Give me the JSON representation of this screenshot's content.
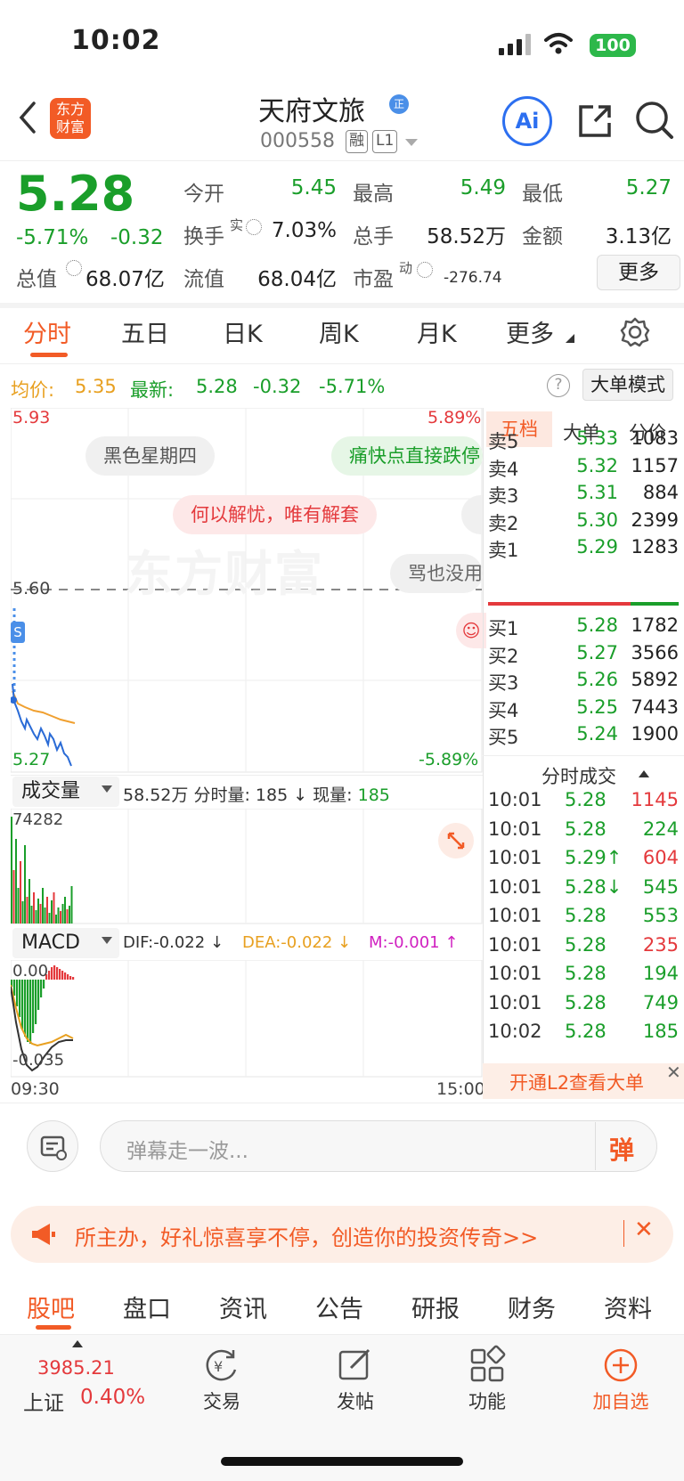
{
  "status": {
    "time": "10:02",
    "battery": "100"
  },
  "header": {
    "logo": "东方财富",
    "title": "天府文旅",
    "code": "000558",
    "tag1": "融",
    "tag2": "L1"
  },
  "quote": {
    "price": "5.28",
    "pct": "-5.71%",
    "chg": "-0.32",
    "rows": [
      [
        {
          "l": "今开",
          "v": "5.45"
        },
        {
          "l": "最高",
          "v": "5.49"
        },
        {
          "l": "最低",
          "v": "5.27"
        }
      ],
      [
        {
          "l": "换手",
          "v": "7.03%"
        },
        {
          "l": "总手",
          "v": "58.52万"
        },
        {
          "l": "金额",
          "v": "3.13亿"
        }
      ],
      [
        {
          "l": "总值",
          "v": "68.07亿"
        },
        {
          "l": "流值",
          "v": "68.04亿"
        },
        {
          "l": "市盈",
          "v": "-276.74"
        }
      ]
    ],
    "turnover_sup": "实",
    "pe_sup": "动",
    "more": "更多"
  },
  "tabs": [
    "分时",
    "五日",
    "日K",
    "周K",
    "月K",
    "更多"
  ],
  "info": {
    "avg_label": "均价:",
    "avg": "5.35",
    "last_label": "最新:",
    "last": "5.28",
    "chg": "-0.32",
    "pct": "-5.71%",
    "mode": "大单模式"
  },
  "chart": {
    "high": "5.93",
    "high_pct": "5.89%",
    "mid": "5.60",
    "low": "5.27",
    "low_pct": "-5.89%",
    "start": "09:30",
    "end": "15:00",
    "watermark": "东方财富"
  },
  "bubbles": [
    "黑色星期四",
    "痛快点直接跌停",
    "何以解忧，唯有解套",
    "骂也没用"
  ],
  "volume": {
    "label": "成交量",
    "total": "58.52万",
    "fs_label": "分时量:",
    "fs": "185",
    "now_label": "现量:",
    "now": "185",
    "max": "74282"
  },
  "macd": {
    "label": "MACD",
    "dif": "DIF:-0.022",
    "dea": "DEA:-0.022",
    "m": "M:-0.001",
    "top": "0.00",
    "bottom": "-0.035"
  },
  "book": {
    "tabs": [
      "五档",
      "大单",
      "分价"
    ],
    "asks": [
      {
        "l": "卖5",
        "p": "5.33",
        "v": "1083"
      },
      {
        "l": "卖4",
        "p": "5.32",
        "v": "1157"
      },
      {
        "l": "卖3",
        "p": "5.31",
        "v": "884"
      },
      {
        "l": "卖2",
        "p": "5.30",
        "v": "2399"
      },
      {
        "l": "卖1",
        "p": "5.29",
        "v": "1283"
      }
    ],
    "bids": [
      {
        "l": "买1",
        "p": "5.28",
        "v": "1782"
      },
      {
        "l": "买2",
        "p": "5.27",
        "v": "3566"
      },
      {
        "l": "买3",
        "p": "5.26",
        "v": "5892"
      },
      {
        "l": "买4",
        "p": "5.25",
        "v": "7443"
      },
      {
        "l": "买5",
        "p": "5.24",
        "v": "1900"
      }
    ],
    "trades_title": "分时成交",
    "trades": [
      {
        "t": "10:01",
        "p": "5.28",
        "v": "1145",
        "c": "r"
      },
      {
        "t": "10:01",
        "p": "5.28",
        "v": "224",
        "c": "g"
      },
      {
        "t": "10:01",
        "p": "5.29↑",
        "v": "604",
        "c": "r"
      },
      {
        "t": "10:01",
        "p": "5.28↓",
        "v": "545",
        "c": "g"
      },
      {
        "t": "10:01",
        "p": "5.28",
        "v": "553",
        "c": "g"
      },
      {
        "t": "10:01",
        "p": "5.28",
        "v": "235",
        "c": "r"
      },
      {
        "t": "10:01",
        "p": "5.28",
        "v": "194",
        "c": "g"
      },
      {
        "t": "10:01",
        "p": "5.28",
        "v": "749",
        "c": "g"
      },
      {
        "t": "10:02",
        "p": "5.28",
        "v": "185",
        "c": "g"
      }
    ],
    "l2": "开通L2查看大单"
  },
  "danmu": {
    "placeholder": "弹幕走一波...",
    "btn": "弹"
  },
  "banner": {
    "text": "所主办，好礼惊喜享不停，创造你的投资传奇>>"
  },
  "bottom_tabs": [
    "股吧",
    "盘口",
    "资讯",
    "公告",
    "研报",
    "财务",
    "资料"
  ],
  "nav": {
    "index_val": "3985.21",
    "index_name": "上证",
    "index_pct": "0.40%",
    "items": [
      "交易",
      "发帖",
      "功能",
      "加自选"
    ]
  }
}
